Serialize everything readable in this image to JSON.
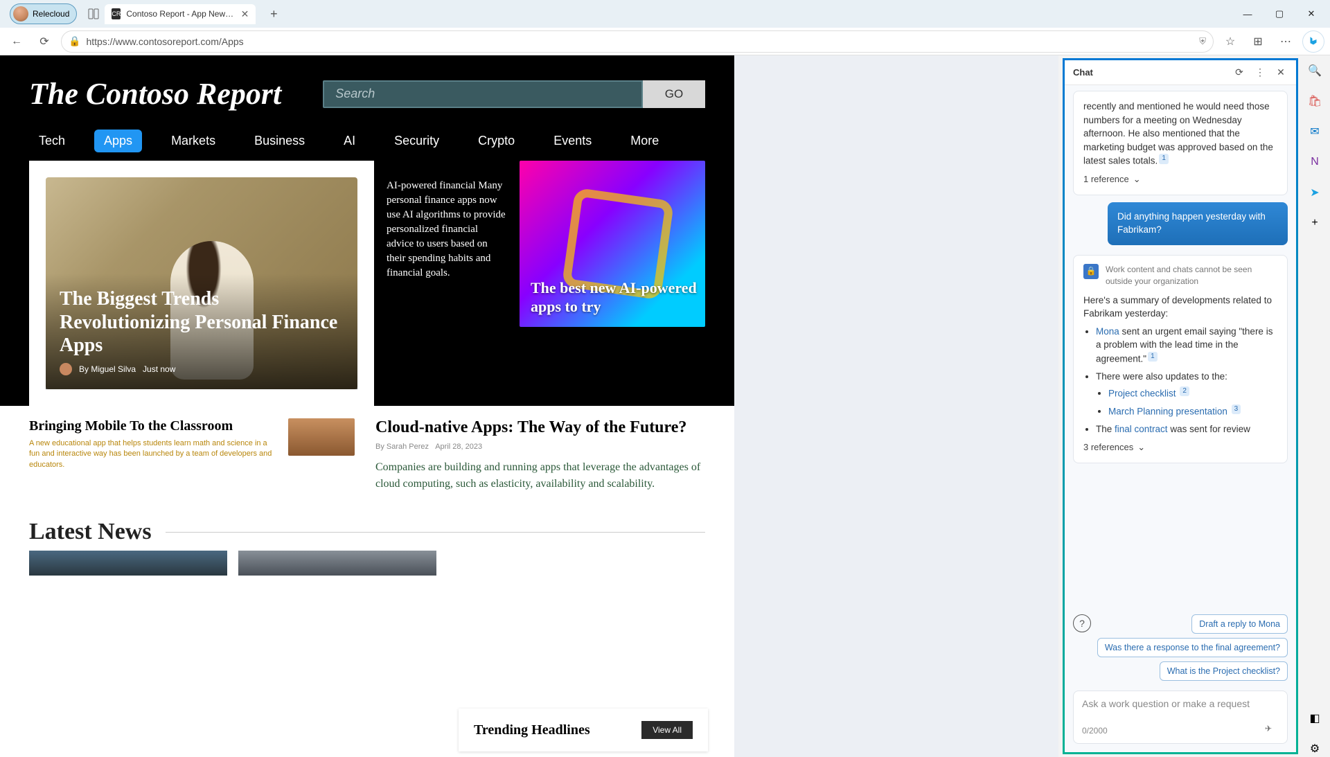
{
  "titlebar": {
    "profile_name": "Relecloud",
    "tab_title": "Contoso Report - App News and Upc",
    "tab_favicon": "CR"
  },
  "toolbar": {
    "url": "https://www.contosoreport.com/Apps",
    "shield_tip": "A|★"
  },
  "site": {
    "title": "The Contoso Report",
    "search_placeholder": "Search",
    "go": "GO",
    "nav": [
      "Tech",
      "Apps",
      "Markets",
      "Business",
      "AI",
      "Security",
      "Crypto",
      "Events",
      "More"
    ],
    "active_nav_index": 1,
    "main_headline": "The Biggest Trends Revolutionizing Personal Finance Apps",
    "main_byline": "By Miguel Silva",
    "main_when": "Just now",
    "mid_blurb": "AI-powered financial Many personal finance apps now use AI algorithms to provide personalized financial advice to users based on their spending habits and financial goals.",
    "right_headline": "The best new AI-powered apps to try",
    "classroom_title": "Bringing Mobile To the Classroom",
    "classroom_blurb": "A new educational app that helps students learn math and science in a fun and interactive way has been launched by a team of developers and educators.",
    "cloud_title": "Cloud-native Apps: The Way of the Future?",
    "cloud_byline": "By Sarah Perez",
    "cloud_date": "April 28, 2023",
    "cloud_excerpt": "Companies are building and running apps that leverage the advantages of cloud computing, such as elasticity, availability and scalability.",
    "latest": "Latest News",
    "trending": "Trending Headlines",
    "view_all": "View All"
  },
  "copilot": {
    "header": "Chat",
    "ai_paragraph": "recently and mentioned he would need those numbers for a meeting on Wednesday afternoon. He also mentioned that the marketing budget was approved based on the latest sales totals.",
    "ref1_label": "1 reference",
    "user_msg": "Did anything happen yesterday with Fabrikam?",
    "privacy": "Work content and chats cannot be seen outside your organization",
    "summary_intro": "Here's a summary of developments related to Fabrikam yesterday:",
    "li1_pre": "Mona",
    "li1_rest": " sent an urgent email saying \"there is a problem with the lead time in the agreement.\"",
    "li2": "There were also updates to the:",
    "li2a": "Project checklist",
    "li2b": "March Planning presentation",
    "li3_pre": "The ",
    "li3_link": "final contract",
    "li3_post": " was sent for review",
    "ref3_label": "3 references",
    "sugg1": "Draft a reply to Mona",
    "sugg2": "Was there a response to the final agreement?",
    "sugg3": "What is the Project checklist?",
    "compose_placeholder": "Ask a work question or make a request",
    "counter": "0/2000"
  }
}
